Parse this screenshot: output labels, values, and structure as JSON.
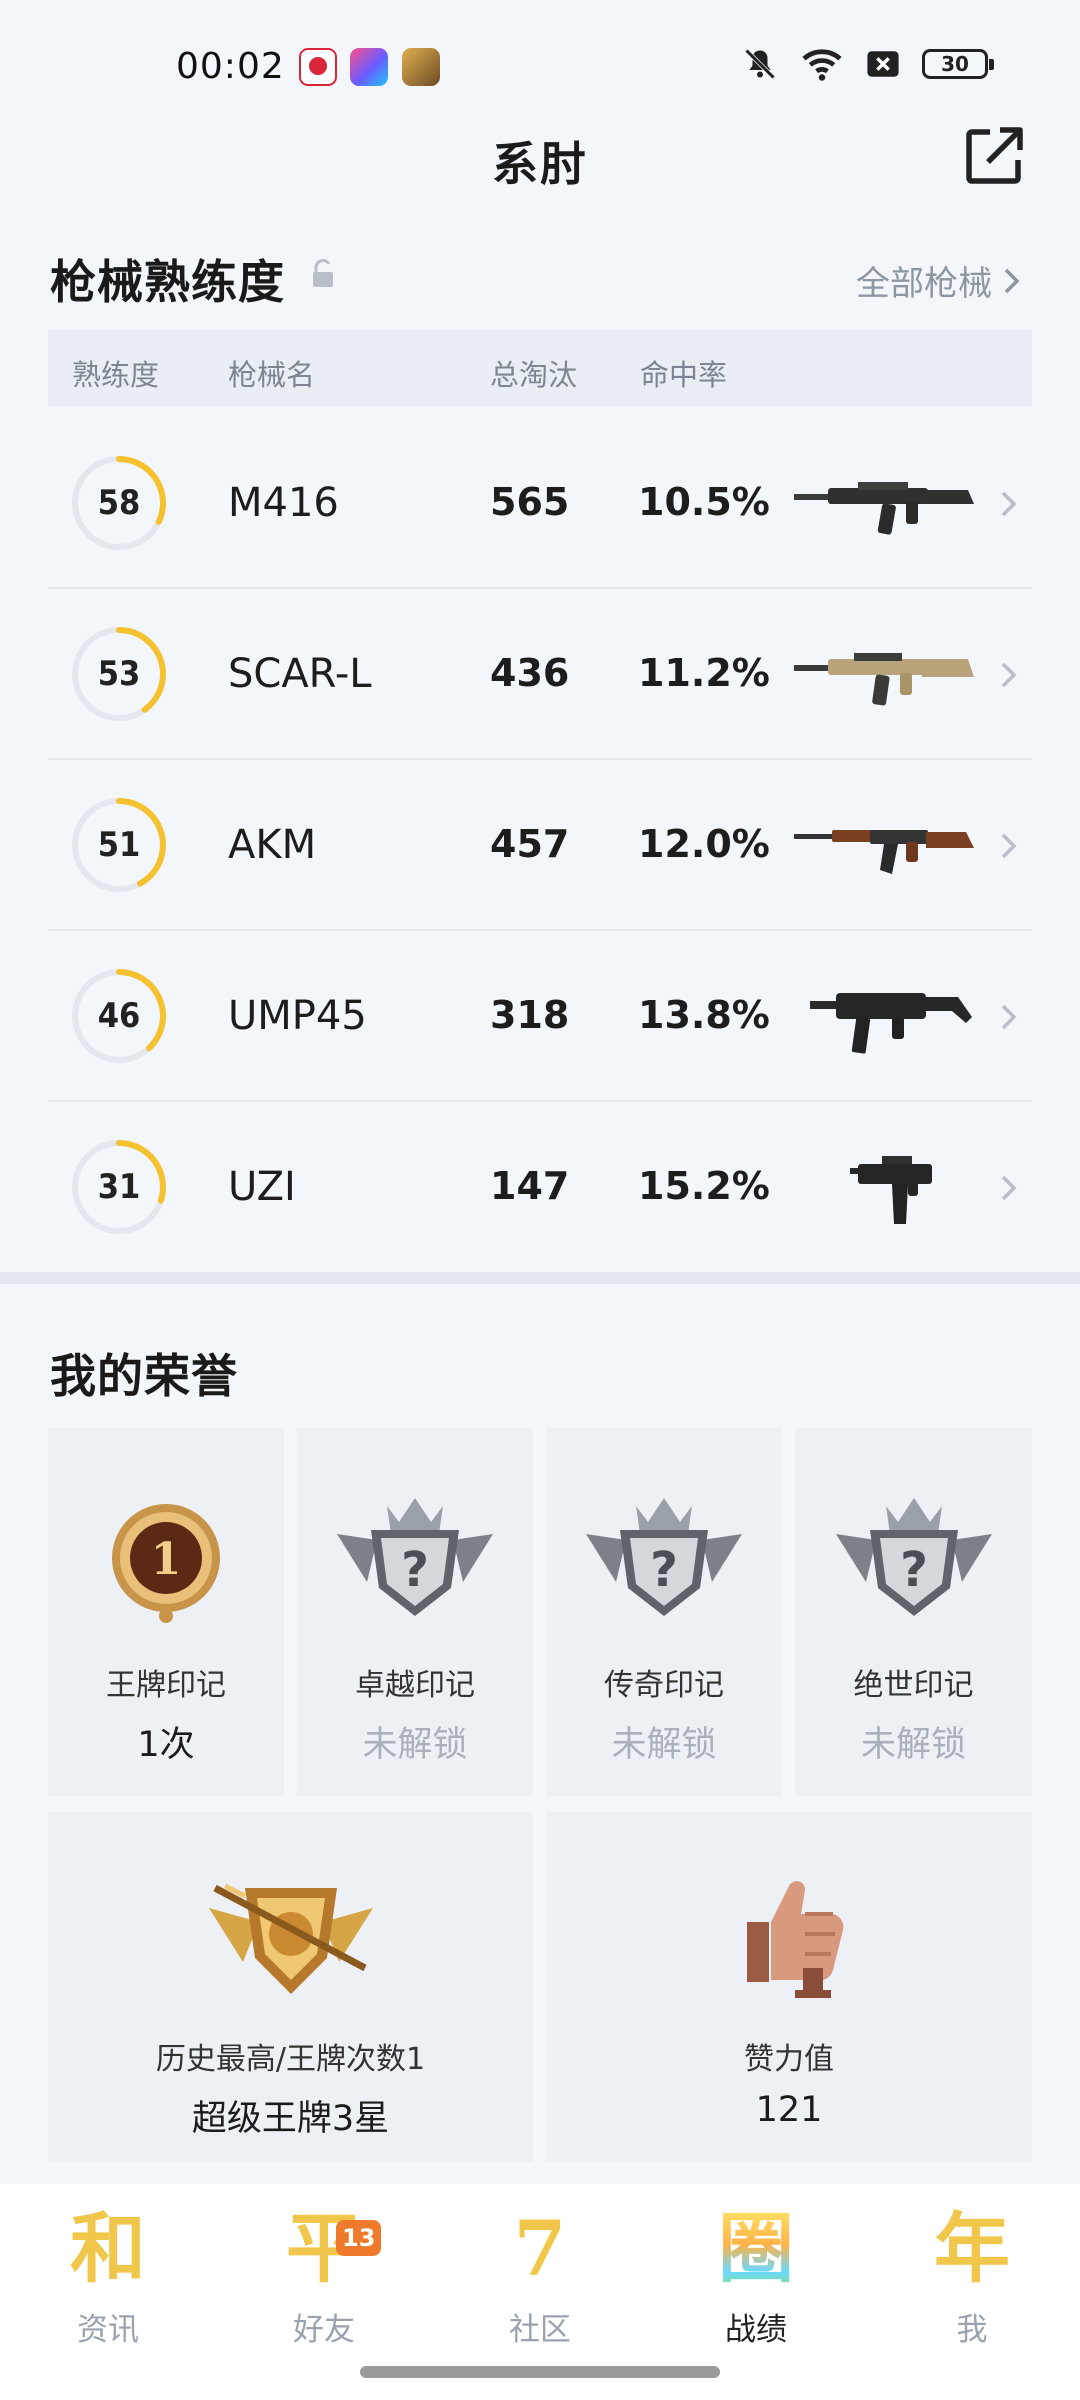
{
  "status_bar": {
    "time": "00:02",
    "battery": "30",
    "icons": [
      "app-icon-1",
      "app-icon-2",
      "app-icon-3",
      "bell-mute-icon",
      "wifi-icon",
      "no-sim-icon",
      "battery-icon"
    ]
  },
  "header": {
    "title": "系肘",
    "share_icon": "share-external-icon"
  },
  "weapons": {
    "title": "枪械熟练度",
    "lock_icon": "lock-icon",
    "all_link": "全部枪械",
    "columns": [
      "熟练度",
      "枪械名",
      "总淘汰",
      "命中率"
    ],
    "ring_color": "#f5c12e",
    "rows": [
      {
        "level": "58",
        "name": "M416",
        "kills": "565",
        "accuracy": "10.5%",
        "progress": 0.32,
        "image": "m416-rifle-image"
      },
      {
        "level": "53",
        "name": "SCAR-L",
        "kills": "436",
        "accuracy": "11.2%",
        "progress": 0.4,
        "image": "scar-l-rifle-image"
      },
      {
        "level": "51",
        "name": "AKM",
        "kills": "457",
        "accuracy": "12.0%",
        "progress": 0.42,
        "image": "akm-rifle-image"
      },
      {
        "level": "46",
        "name": "UMP45",
        "kills": "318",
        "accuracy": "13.8%",
        "progress": 0.38,
        "image": "ump45-smg-image"
      },
      {
        "level": "31",
        "name": "UZI",
        "kills": "147",
        "accuracy": "15.2%",
        "progress": 0.3,
        "image": "uzi-smg-image"
      }
    ]
  },
  "honors": {
    "title": "我的荣誉",
    "badges": [
      {
        "label": "王牌印记",
        "value": "1次",
        "locked": false,
        "icon": "ace-medal-icon"
      },
      {
        "label": "卓越印记",
        "value": "未解锁",
        "locked": true,
        "icon": "locked-crest-icon"
      },
      {
        "label": "传奇印记",
        "value": "未解锁",
        "locked": true,
        "icon": "locked-crest-icon"
      },
      {
        "label": "绝世印记",
        "value": "未解锁",
        "locked": true,
        "icon": "locked-crest-icon"
      }
    ],
    "big": [
      {
        "label": "历史最高/王牌次数1",
        "value": "超级王牌3星",
        "icon": "ace-rank-emblem-icon"
      },
      {
        "label": "赞力值",
        "value": "121",
        "icon": "thumbs-up-icon"
      }
    ]
  },
  "bottom_nav": {
    "items": [
      {
        "glyph": "和",
        "label": "资讯",
        "active": false
      },
      {
        "glyph": "平",
        "label": "好友",
        "active": false,
        "badge": "13"
      },
      {
        "glyph": "7",
        "label": "社区",
        "active": false
      },
      {
        "glyph": "圈",
        "label": "战绩",
        "active": true
      },
      {
        "glyph": "年",
        "label": "我",
        "active": false
      }
    ]
  }
}
